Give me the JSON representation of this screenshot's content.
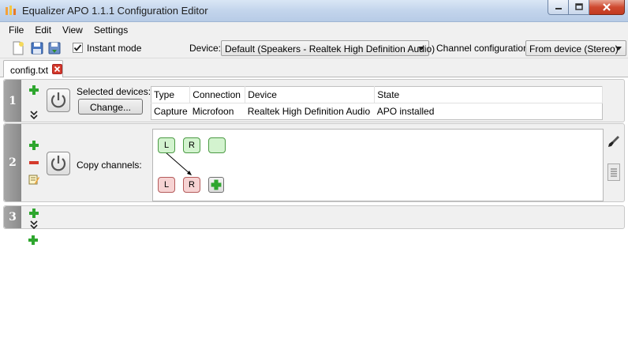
{
  "window": {
    "title": "Equalizer APO 1.1.1 Configuration Editor"
  },
  "menu": [
    "File",
    "Edit",
    "View",
    "Settings"
  ],
  "toolbar": {
    "instant_mode_label": "Instant mode",
    "instant_mode_checked": true,
    "device_label": "Device:",
    "device_value": "Default (Speakers - Realtek High Definition Audio)",
    "channel_label": "Channel configuration:",
    "channel_value": "From device (Stereo)"
  },
  "tab": {
    "label": "config.txt"
  },
  "rows": [
    {
      "number": "1",
      "selected_devices_label": "Selected devices:",
      "change_button": "Change...",
      "table": {
        "headers": [
          "Type",
          "Connection",
          "Device",
          "State"
        ],
        "cells": [
          "Capture",
          "Microfoon",
          "Realtek High Definition Audio",
          "APO installed"
        ]
      }
    },
    {
      "number": "2",
      "copy_channels_label": "Copy channels:",
      "source_channels": [
        "L",
        "R",
        ""
      ],
      "target_channels": [
        "L",
        "R"
      ]
    },
    {
      "number": "3"
    }
  ],
  "colors": {
    "add": "#2ea62e",
    "remove": "#d43a2b",
    "channel_source": "#d3f3cf",
    "channel_target": "#f6d3d3"
  },
  "icons": [
    "app-icon",
    "new-file-icon",
    "save-icon",
    "save-as-icon",
    "add-icon",
    "remove-icon",
    "edit-icon",
    "power-icon",
    "expand-icon",
    "brush-icon",
    "document-icon",
    "minimize-icon",
    "maximize-icon",
    "close-icon"
  ]
}
